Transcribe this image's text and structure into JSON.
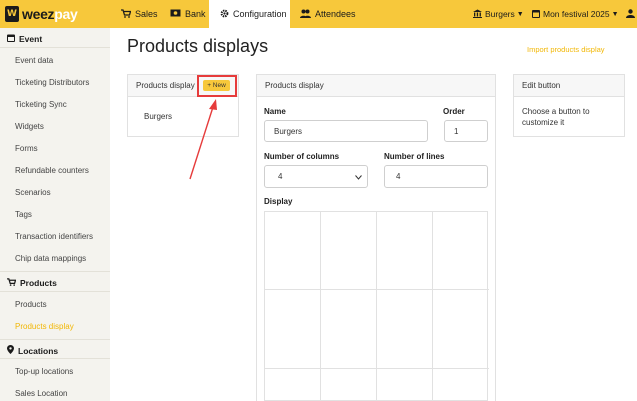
{
  "topbar": {
    "logo_first": "weez",
    "logo_second": "pay",
    "logo_mark": "W",
    "nav": [
      {
        "label": "Sales",
        "icon": "cart-icon"
      },
      {
        "label": "Bank",
        "icon": "money-icon"
      },
      {
        "label": "Configuration",
        "icon": "gear-icon"
      },
      {
        "label": "Attendees",
        "icon": "users-icon"
      }
    ],
    "active_nav": "Configuration",
    "shop_select": "Burgers",
    "event_select": "Mon festival 2025"
  },
  "sidebar": {
    "sections": [
      {
        "label": "Event",
        "icon": "calendar-icon",
        "items": [
          "Event data",
          "Ticketing Distributors",
          "Ticketing Sync",
          "Widgets",
          "Forms",
          "Refundable counters",
          "Scenarios",
          "Tags",
          "Transaction identifiers",
          "Chip data mappings"
        ]
      },
      {
        "label": "Products",
        "icon": "cart-icon",
        "items": [
          "Products",
          "Products display"
        ]
      },
      {
        "label": "Locations",
        "icon": "map-marker-icon",
        "items": [
          "Top-up locations",
          "Sales Location"
        ]
      }
    ],
    "active_item": "Products display"
  },
  "main": {
    "title": "Products displays",
    "import_link": "Import products display",
    "list_panel": {
      "header": "Products display",
      "new_button": "+ New",
      "items": [
        "Burgers"
      ]
    },
    "edit_panel": {
      "header": "Products display",
      "name_label": "Name",
      "name_value": "Burgers",
      "order_label": "Order",
      "order_value": "1",
      "columns_label": "Number of columns",
      "columns_value": "4",
      "lines_label": "Number of lines",
      "lines_value": "4",
      "display_label": "Display"
    },
    "button_panel": {
      "header": "Edit button",
      "body": "Choose a button to customize it"
    }
  },
  "colors": {
    "brand": "#f7c83b",
    "link": "#f2b705",
    "annotation": "#e63b3b"
  }
}
